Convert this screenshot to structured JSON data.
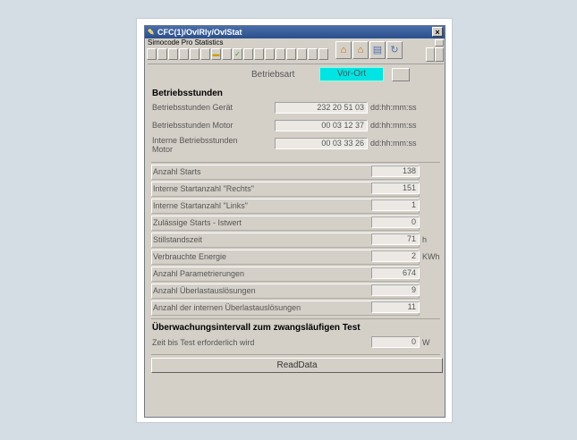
{
  "window": {
    "title": "CFC(1)/OvlRly/OvlStat",
    "close_glyph": "×"
  },
  "toolbar": {
    "app_label": "Simocode Pro Statistics"
  },
  "betriebsart": {
    "label": "Betriebsart",
    "value": "Vor-Ort"
  },
  "section1": {
    "title": "Betriebsstunden",
    "rows": [
      {
        "label": "Betriebsstunden Gerät",
        "dd": "232",
        "hh": "20",
        "mm": "51",
        "ss": "03",
        "unit": "dd:hh:mm:ss"
      },
      {
        "label": "Betriebsstunden Motor",
        "dd": "00",
        "hh": "03",
        "mm": "12",
        "ss": "37",
        "unit": "dd:hh:mm:ss"
      },
      {
        "label": "Interne Betriebsstunden Motor",
        "dd": "00",
        "hh": "03",
        "mm": "33",
        "ss": "26",
        "unit": "dd:hh:mm:ss"
      }
    ]
  },
  "stats": [
    {
      "label": "Anzahl Starts",
      "value": "138",
      "unit": ""
    },
    {
      "label": "Interne Startanzahl \"Rechts\"",
      "value": "151",
      "unit": ""
    },
    {
      "label": "Interne Startanzahl \"Links\"",
      "value": "1",
      "unit": ""
    },
    {
      "label": "Zulässige Starts - Istwert",
      "value": "0",
      "unit": ""
    },
    {
      "label": "Stillstandszeit",
      "value": "71",
      "unit": "h"
    },
    {
      "label": "Verbrauchte Energie",
      "value": "2",
      "unit": "KWh"
    },
    {
      "label": "Anzahl Parametrierungen",
      "value": "674",
      "unit": ""
    },
    {
      "label": "Anzahl Überlastauslösungen",
      "value": "9",
      "unit": ""
    },
    {
      "label": "Anzahl der internen Überlastauslösungen",
      "value": "11",
      "unit": ""
    }
  ],
  "section2": {
    "title": "Überwachungsintervall zum zwangsläufigen Test",
    "label": "Zeit bis Test erforderlich wird",
    "value": "0",
    "unit": "W"
  },
  "readdata_label": "ReadData",
  "colors": {
    "mode_highlight": "#00e4e4",
    "panel": "#d4d0c8",
    "titlebar": "#2b4f8c"
  },
  "icons": [
    "pencil-icon",
    "folder-icon",
    "check-icon",
    "house-icon",
    "house-arrow-icon",
    "document-icon",
    "refresh-icon"
  ]
}
